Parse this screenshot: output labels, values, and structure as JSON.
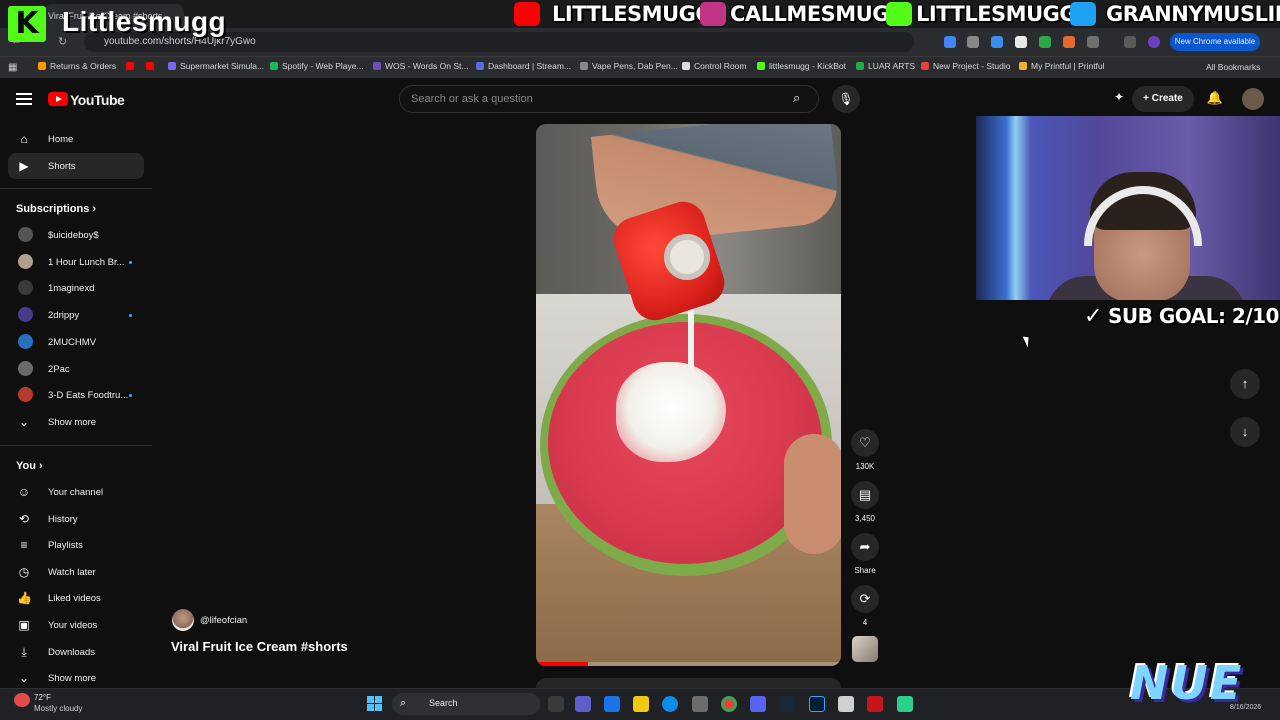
{
  "overlay": {
    "brand": "Littlesmugg",
    "kick_letter": "K",
    "socials": [
      {
        "handle": "LITTLESMUGG",
        "platform": "youtube-icon",
        "color": "#ff0000"
      },
      {
        "handle": "CALLMESMUGG",
        "platform": "instagram-icon",
        "color": "#c13584"
      },
      {
        "handle": "LITTLESMUGG",
        "platform": "kick-icon",
        "color": "#53fc18"
      },
      {
        "handle": "GRANNYMUSLIM",
        "platform": "twitter-icon",
        "color": "#1da1f2"
      }
    ],
    "sub_goal": "SUB GOAL: 2/10",
    "nue": "NUE"
  },
  "browser": {
    "tab_title": "Viral Fruit Ice Cream #shorts",
    "url": "youtube.com/shorts/H4Ujkr7yGwo",
    "new_chrome": "New Chrome available",
    "bookmarks": [
      {
        "label": "Returns & Orders",
        "color": "#ff9900"
      },
      {
        "label": "",
        "color": "#ff0000"
      },
      {
        "label": "",
        "color": "#ff0000"
      },
      {
        "label": "Supermarket Simula...",
        "color": "#7b68ee"
      },
      {
        "label": "Spotify - Web Playe...",
        "color": "#1db954"
      },
      {
        "label": "WOS - Words On St...",
        "color": "#6b4fbb"
      },
      {
        "label": "Dashboard | Stream...",
        "color": "#5b6ee1"
      },
      {
        "label": "Vape Pens, Dab Pen...",
        "color": "#888888"
      },
      {
        "label": "Control Room",
        "color": "#dddddd"
      },
      {
        "label": "littlesmugg - KickBot",
        "color": "#53fc18"
      },
      {
        "label": "LUAR ARTS",
        "color": "#22aa44"
      },
      {
        "label": "New Project - Studio",
        "color": "#e0443c"
      },
      {
        "label": "My Printful | Printful",
        "color": "#f2b134"
      }
    ],
    "all_bookmarks": "All Bookmarks"
  },
  "youtube": {
    "logo_text": "YouTube",
    "search_placeholder": "Search or ask a question",
    "create_label": "Create",
    "nav": [
      {
        "label": "Home",
        "icon": "home-icon"
      },
      {
        "label": "Shorts",
        "icon": "shorts-icon",
        "active": true
      }
    ],
    "subscriptions_title": "Subscriptions",
    "subscriptions": [
      {
        "label": "$uicideboy$",
        "color": "#555555",
        "new": false
      },
      {
        "label": "1 Hour Lunch Br...",
        "color": "#b0a090",
        "new": true
      },
      {
        "label": "1maginexd",
        "color": "#3a3a3a",
        "new": false
      },
      {
        "label": "2drippy",
        "color": "#4a3a8a",
        "new": true
      },
      {
        "label": "2MUCHMV",
        "color": "#2a6fbf",
        "new": false
      },
      {
        "label": "2Pac",
        "color": "#6a6a6a",
        "new": false
      },
      {
        "label": "3-D Eats Foodtru...",
        "color": "#b83a2a",
        "new": true
      }
    ],
    "show_more": "Show more",
    "you_title": "You",
    "you_items": [
      {
        "label": "Your channel",
        "icon": "channel-icon"
      },
      {
        "label": "History",
        "icon": "history-icon"
      },
      {
        "label": "Playlists",
        "icon": "playlists-icon"
      },
      {
        "label": "Watch later",
        "icon": "watch-later-icon"
      },
      {
        "label": "Liked videos",
        "icon": "like-icon"
      },
      {
        "label": "Your videos",
        "icon": "your-videos-icon"
      },
      {
        "label": "Downloads",
        "icon": "download-icon"
      }
    ],
    "show_more_2": "Show more",
    "short": {
      "creator": "@lifeofcian",
      "title": "Viral Fruit Ice Cream #shorts",
      "likes": "130K",
      "comments": "3,450",
      "share": "Share",
      "remix": "4",
      "progress": 0.17
    }
  },
  "taskbar": {
    "temp": "72°F",
    "weather": "Mostly cloudy",
    "search": "Search",
    "date": "8/16/2026"
  }
}
